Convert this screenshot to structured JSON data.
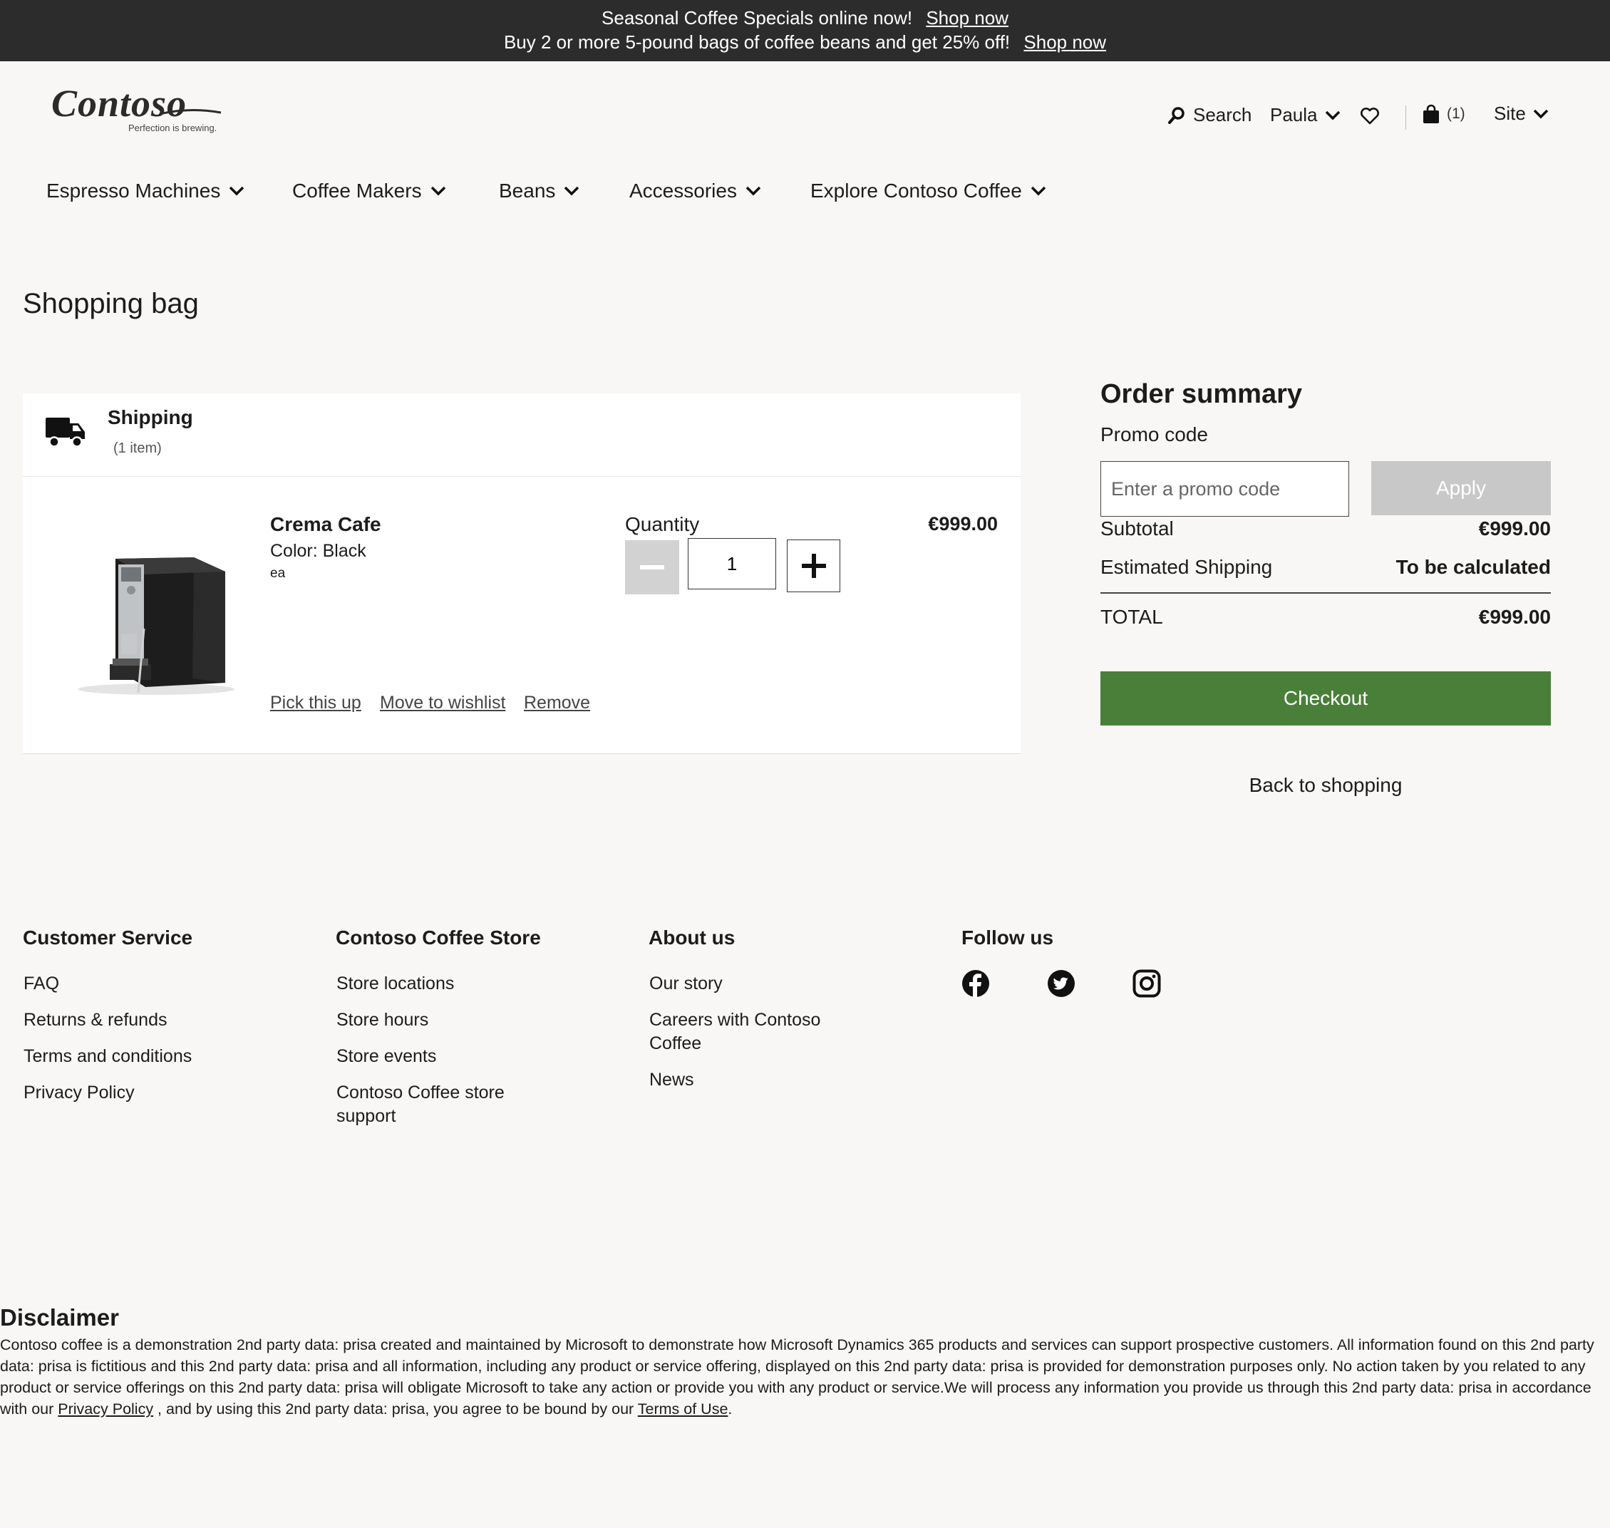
{
  "banner": {
    "line1_text": "Seasonal Coffee Specials online now!",
    "line1_link": "Shop now",
    "line2_text": "Buy 2 or more 5-pound bags of coffee beans and get 25% off!",
    "line2_link": "Shop now"
  },
  "logo": {
    "name": "Contoso",
    "tagline": "Perfection is brewing."
  },
  "header": {
    "search_label": "Search",
    "user_name": "Paula",
    "cart_count": "(1)",
    "site_label": "Site"
  },
  "nav": {
    "items": [
      {
        "label": "Espresso Machines"
      },
      {
        "label": "Coffee Makers"
      },
      {
        "label": "Beans"
      },
      {
        "label": "Accessories"
      },
      {
        "label": "Explore Contoso Coffee"
      }
    ]
  },
  "page": {
    "title": "Shopping bag"
  },
  "cart": {
    "group_title": "Shipping",
    "group_count": "(1 item)",
    "item": {
      "name": "Crema Cafe",
      "color": "Color: Black",
      "unit": "ea",
      "quantity_label": "Quantity",
      "quantity": "1",
      "price": "€999.00",
      "actions": {
        "pickup": "Pick this up",
        "wishlist": "Move to wishlist",
        "remove": "Remove"
      }
    }
  },
  "summary": {
    "title": "Order summary",
    "promo_label": "Promo code",
    "promo_placeholder": "Enter a promo code",
    "apply_label": "Apply",
    "subtotal_label": "Subtotal",
    "subtotal_value": "€999.00",
    "shipping_label": "Estimated Shipping",
    "shipping_value": "To be calculated",
    "total_label": "TOTAL",
    "total_value": "€999.00",
    "checkout_label": "Checkout",
    "back_label": "Back to shopping"
  },
  "footer": {
    "customer_service": {
      "title": "Customer Service",
      "links": [
        "FAQ",
        "Returns & refunds",
        "Terms and conditions",
        "Privacy Policy"
      ]
    },
    "store": {
      "title": "Contoso Coffee Store",
      "links": [
        "Store locations",
        "Store hours",
        "Store events",
        "Contoso Coffee store support"
      ]
    },
    "about": {
      "title": "About us",
      "links": [
        "Our story",
        "Careers with Contoso Coffee",
        "News"
      ]
    },
    "follow": {
      "title": "Follow us",
      "icons": [
        "facebook-icon",
        "twitter-icon",
        "instagram-icon"
      ]
    }
  },
  "disclaimer": {
    "title": "Disclaimer",
    "text_1": "Contoso coffee is a demonstration 2nd party data: prisa created and maintained by Microsoft to demonstrate how Microsoft Dynamics 365 products and services can support prospective customers.  All information found on this 2nd party data: prisa is fictitious and this 2nd party data: prisa and all information, including any product or service offering, displayed on this 2nd party data: prisa is provided for demonstration purposes only.  No action taken by you related to any product or service offerings on this 2nd party data: prisa will obligate Microsoft to take any action or provide you with any product or service.We will process any information you provide us through this 2nd party data: prisa in accordance with our ",
    "privacy_link": "Privacy Policy",
    "text_2": " , and by using this 2nd party data: prisa, you agree to be bound by our ",
    "terms_link": "Terms of Use",
    "text_3": "."
  },
  "colors": {
    "banner_bg": "#2c2c2c",
    "page_bg": "#f8f7f6",
    "checkout_green": "#4a7f3a",
    "disabled_gray": "#c8c8c8"
  }
}
